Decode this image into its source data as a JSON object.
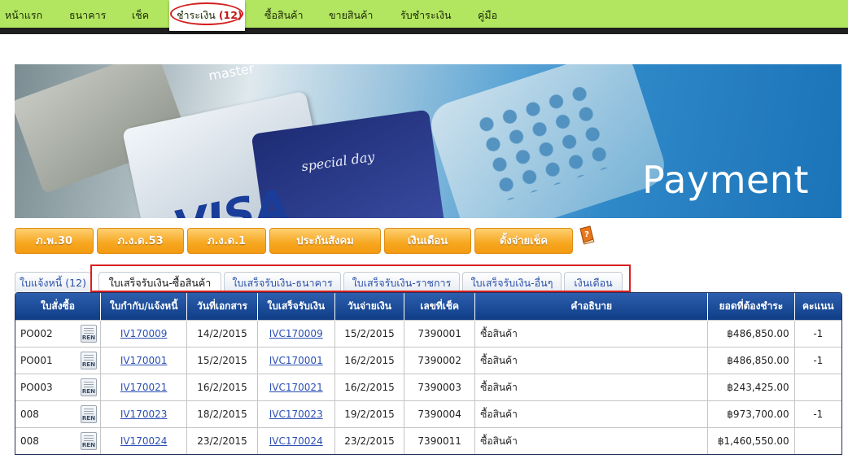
{
  "nav": {
    "items": [
      {
        "label": "หน้าแรก"
      },
      {
        "label": "ธนาคาร"
      },
      {
        "label": "เช็ค"
      },
      {
        "label": "ชำระเงิน",
        "count": "(12)"
      },
      {
        "label": "ซื้อสินค้า"
      },
      {
        "label": "ขายสินค้า"
      },
      {
        "label": "รับชำระเงิน"
      },
      {
        "label": "คู่มือ"
      }
    ],
    "active_index": 3
  },
  "banner": {
    "title": "Payment",
    "card_text_visa": "VISA",
    "card_text_special": "special day",
    "card_text_master": "master"
  },
  "buttons": [
    {
      "label": "ภ.พ.30"
    },
    {
      "label": "ภ.ง.ด.53"
    },
    {
      "label": "ภ.ง.ด.1"
    },
    {
      "label": "ประกันสังคม"
    },
    {
      "label": "เงินเดือน"
    },
    {
      "label": "ตั้งจ่ายเช็ค"
    }
  ],
  "help_icon": "help-book-icon",
  "tabs": [
    {
      "label": "ใบแจ้งหนี้ (12)"
    },
    {
      "label": "ใบเสร็จรับเงิน-ซื้อสินค้า",
      "active": true
    },
    {
      "label": "ใบเสร็จรับเงิน-ธนาคาร"
    },
    {
      "label": "ใบเสร็จรับเงิน-ราชการ"
    },
    {
      "label": "ใบเสร็จรับเงิน-อื่นๆ"
    },
    {
      "label": "เงินเดือน"
    }
  ],
  "table": {
    "columns": [
      "ใบสั่งซื้อ",
      "ใบกำกับ/แจ้งหนี้",
      "วันที่เอกสาร",
      "ใบเสร็จรับเงิน",
      "วันจ่ายเงิน",
      "เลขที่เช็ค",
      "คำอธิบาย",
      "ยอดที่ต้องชำระ",
      "คะแนน"
    ],
    "row_icon_label": "REN",
    "rows": [
      {
        "po": "PO002",
        "invoice": "IV170009",
        "doc_date": "14/2/2015",
        "receipt": "IVC170009",
        "pay_date": "15/2/2015",
        "cheque": "7390001",
        "desc": "ซื้อสินค้า",
        "amount": "฿486,850.00",
        "score": "-1"
      },
      {
        "po": "PO001",
        "invoice": "IV170001",
        "doc_date": "15/2/2015",
        "receipt": "IVC170001",
        "pay_date": "16/2/2015",
        "cheque": "7390002",
        "desc": "ซื้อสินค้า",
        "amount": "฿486,850.00",
        "score": "-1"
      },
      {
        "po": "PO003",
        "invoice": "IV170021",
        "doc_date": "16/2/2015",
        "receipt": "IVC170021",
        "pay_date": "16/2/2015",
        "cheque": "7390003",
        "desc": "ซื้อสินค้า",
        "amount": "฿243,425.00",
        "score": ""
      },
      {
        "po": "008",
        "invoice": "IV170023",
        "doc_date": "18/2/2015",
        "receipt": "IVC170023",
        "pay_date": "19/2/2015",
        "cheque": "7390004",
        "desc": "ซื้อสินค้า",
        "amount": "฿973,700.00",
        "score": "-1"
      },
      {
        "po": "008",
        "invoice": "IV170024",
        "doc_date": "23/2/2015",
        "receipt": "IVC170024",
        "pay_date": "23/2/2015",
        "cheque": "7390011",
        "desc": "ซื้อสินค้า",
        "amount": "฿1,460,550.00",
        "score": ""
      }
    ]
  },
  "colors": {
    "nav_bg": "#b3e660",
    "nav_bar": "#1f1f1f",
    "button_orange": "#f6a71f",
    "table_header": "#1a4a96",
    "link_blue": "#2b4fb3",
    "highlight_red": "#d81f1f"
  }
}
